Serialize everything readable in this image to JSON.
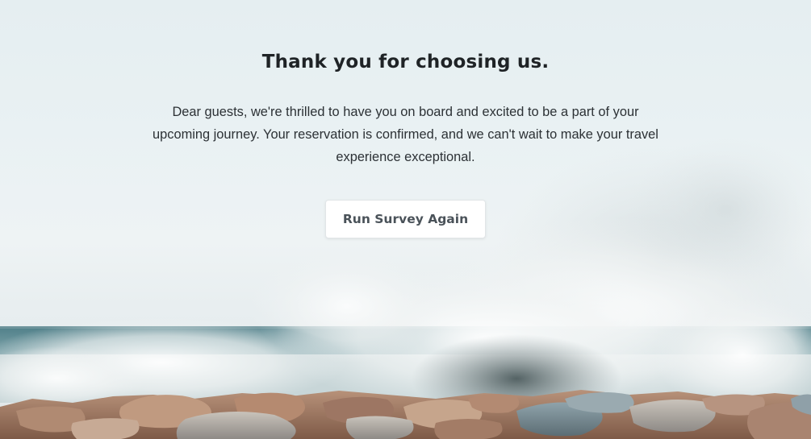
{
  "page": {
    "title": "Thank you for choosing us.",
    "message": "Dear guests, we're thrilled to have you on board and excited to be a part of your upcoming journey. Your reservation is confirmed, and we can't wait to make your travel experience exceptional.",
    "button_label": "Run Survey Again"
  },
  "background": {
    "description_icon": "ocean-waves-rocks-image",
    "sky_color": "#e6eff2",
    "sea_color": "#5f8e96",
    "rock_color": "#a9826c",
    "spray_color": "#f4f6f6"
  }
}
